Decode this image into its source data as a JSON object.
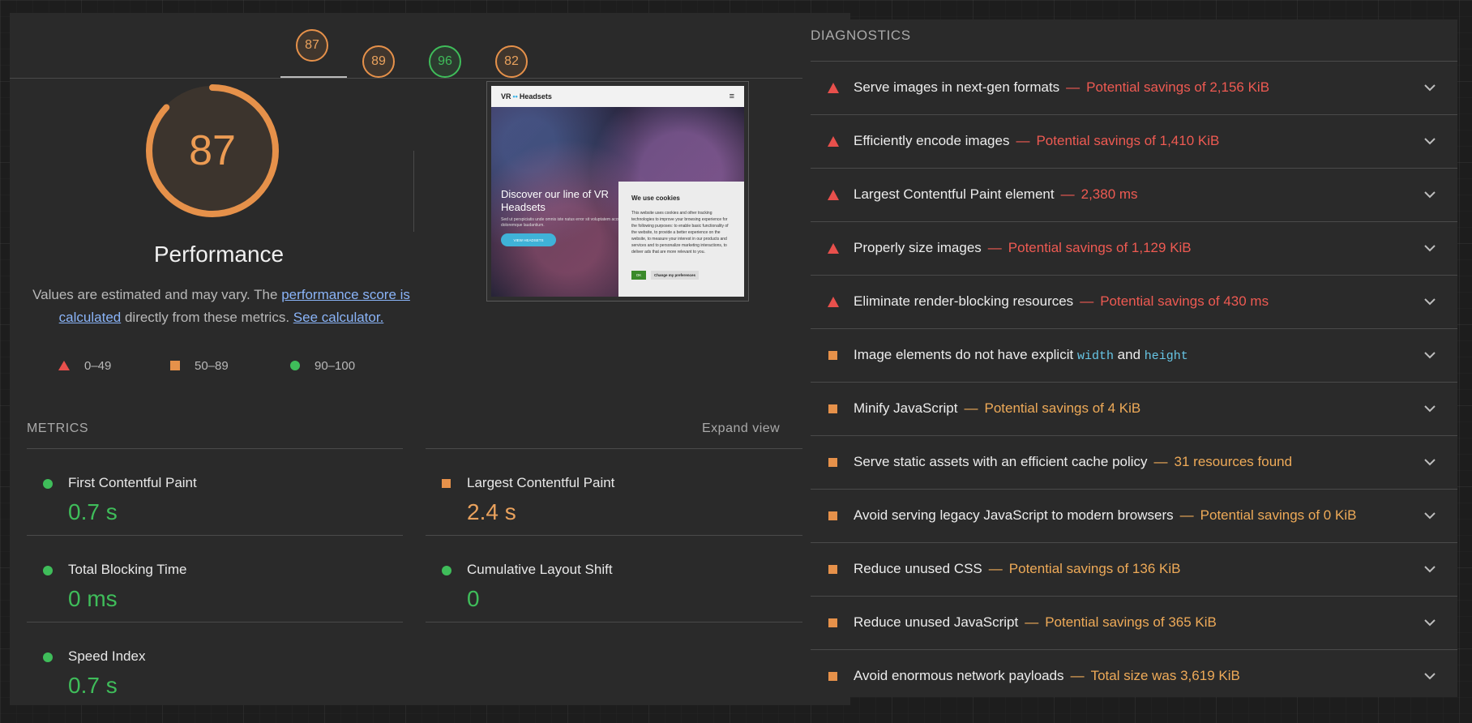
{
  "tabs": [
    {
      "score": "87",
      "color": "orange"
    },
    {
      "score": "89",
      "color": "orange"
    },
    {
      "score": "96",
      "color": "green"
    },
    {
      "score": "82",
      "color": "orange"
    }
  ],
  "gauge": {
    "score": "87",
    "fraction": 0.87,
    "color": "#e6914a"
  },
  "performance": {
    "title": "Performance",
    "desc_prefix": "Values are estimated and may vary. The ",
    "desc_link1": "performance score is calculated",
    "desc_middle": " directly from these metrics. ",
    "desc_link2": "See calculator."
  },
  "legend": [
    {
      "shape": "triangle",
      "label": "0–49"
    },
    {
      "shape": "square",
      "label": "50–89"
    },
    {
      "shape": "circle",
      "label": "90–100"
    }
  ],
  "thumbnail": {
    "brand_vr": "VR",
    "brand_dots": "••",
    "brand_name": "Headsets",
    "menu_icon": "≡",
    "hero_title": "Discover our line of VR Headsets",
    "hero_sub": "Sed ut perspiciatis unde omnis iste natus error sit voluptatem accusantium doloremque laudantium.",
    "hero_button": "VIEW HEADSETS",
    "cookie_title": "We use cookies",
    "cookie_text": "This website uses cookies and other tracking technologies to improve your browsing experience for the following purposes: to enable basic functionality of the website, to provide a better experience on the website, to measure your interest in our products and services and to personalize marketing interactions, to deliver ads that are more relevant to you.",
    "cookie_ok": "OK",
    "cookie_pref": "Change my preferences"
  },
  "metrics": {
    "label": "METRICS",
    "expand": "Expand view",
    "items": [
      {
        "name": "First Contentful Paint",
        "value": "0.7 s",
        "status": "green"
      },
      {
        "name": "Largest Contentful Paint",
        "value": "2.4 s",
        "status": "orange"
      },
      {
        "name": "Total Blocking Time",
        "value": "0 ms",
        "status": "green"
      },
      {
        "name": "Cumulative Layout Shift",
        "value": "0",
        "status": "green"
      },
      {
        "name": "Speed Index",
        "value": "0.7 s",
        "status": "green"
      }
    ]
  },
  "diagnostics": {
    "label": "DIAGNOSTICS",
    "items": [
      {
        "severity": "fail",
        "title": "Serve images in next-gen formats",
        "detail": "Potential savings of 2,156 KiB"
      },
      {
        "severity": "fail",
        "title": "Efficiently encode images",
        "detail": "Potential savings of 1,410 KiB"
      },
      {
        "severity": "fail",
        "title": "Largest Contentful Paint element",
        "detail": "2,380 ms"
      },
      {
        "severity": "fail",
        "title": "Properly size images",
        "detail": "Potential savings of 1,129 KiB"
      },
      {
        "severity": "fail",
        "title": "Eliminate render-blocking resources",
        "detail": "Potential savings of 430 ms"
      },
      {
        "severity": "average",
        "title_parts": [
          "Image elements do not have explicit ",
          "width",
          " and ",
          "height"
        ],
        "detail": ""
      },
      {
        "severity": "average",
        "title": "Minify JavaScript",
        "detail": "Potential savings of 4 KiB"
      },
      {
        "severity": "average",
        "title": "Serve static assets with an efficient cache policy",
        "detail": "31 resources found"
      },
      {
        "severity": "average",
        "title": "Avoid serving legacy JavaScript to modern browsers",
        "detail": "Potential savings of 0 KiB"
      },
      {
        "severity": "average",
        "title": "Reduce unused CSS",
        "detail": "Potential savings of 136 KiB"
      },
      {
        "severity": "average",
        "title": "Reduce unused JavaScript",
        "detail": "Potential savings of 365 KiB"
      },
      {
        "severity": "average",
        "title": "Avoid enormous network payloads",
        "detail": "Total size was 3,619 KiB"
      }
    ],
    "separator": "—"
  }
}
